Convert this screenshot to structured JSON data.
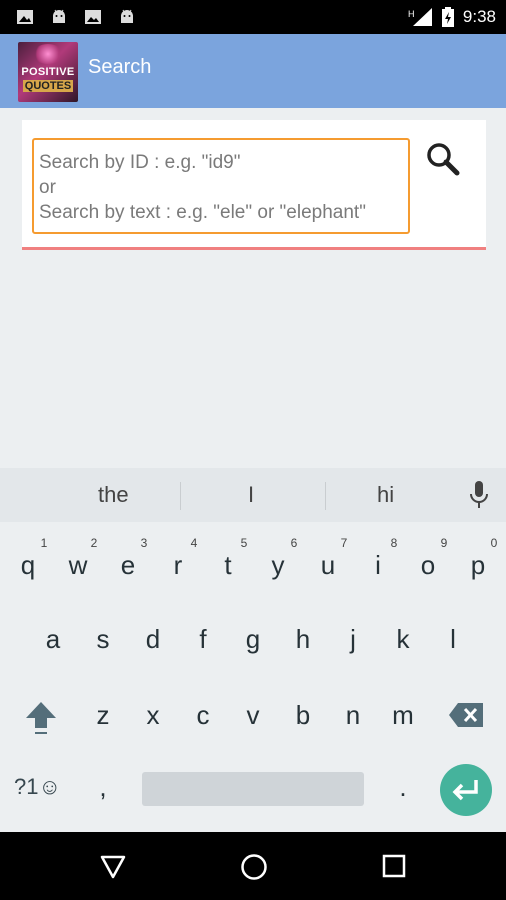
{
  "status_bar": {
    "time": "9:38",
    "icons": [
      "gallery-icon",
      "android-icon",
      "image-icon",
      "android-icon",
      "signal-icon",
      "battery-icon"
    ],
    "signal_label": "H"
  },
  "app_bar": {
    "logo_line1": "POSITIVE",
    "logo_line2": "QUOTES",
    "title": "Search",
    "color": "#7ba4dd"
  },
  "search": {
    "placeholder": "Search by ID : e.g. \"id9\"\nor\nSearch by text : e.g. \"ele\" or \"elephant\"",
    "border_color": "#f59b30",
    "underline_color": "#f08080"
  },
  "keyboard": {
    "suggestions": [
      "the",
      "I",
      "hi"
    ],
    "row1": [
      {
        "key": "q",
        "hint": "1"
      },
      {
        "key": "w",
        "hint": "2"
      },
      {
        "key": "e",
        "hint": "3"
      },
      {
        "key": "r",
        "hint": "4"
      },
      {
        "key": "t",
        "hint": "5"
      },
      {
        "key": "y",
        "hint": "6"
      },
      {
        "key": "u",
        "hint": "7"
      },
      {
        "key": "i",
        "hint": "8"
      },
      {
        "key": "o",
        "hint": "9"
      },
      {
        "key": "p",
        "hint": "0"
      }
    ],
    "row2": [
      "a",
      "s",
      "d",
      "f",
      "g",
      "h",
      "j",
      "k",
      "l"
    ],
    "row3": [
      "z",
      "x",
      "c",
      "v",
      "b",
      "n",
      "m"
    ],
    "symbols_label": "?1☺",
    "comma": ",",
    "period": ".",
    "enter_color": "#45b39c"
  },
  "nav_bar": {
    "icons": [
      "back-icon",
      "home-icon",
      "recents-icon"
    ]
  }
}
